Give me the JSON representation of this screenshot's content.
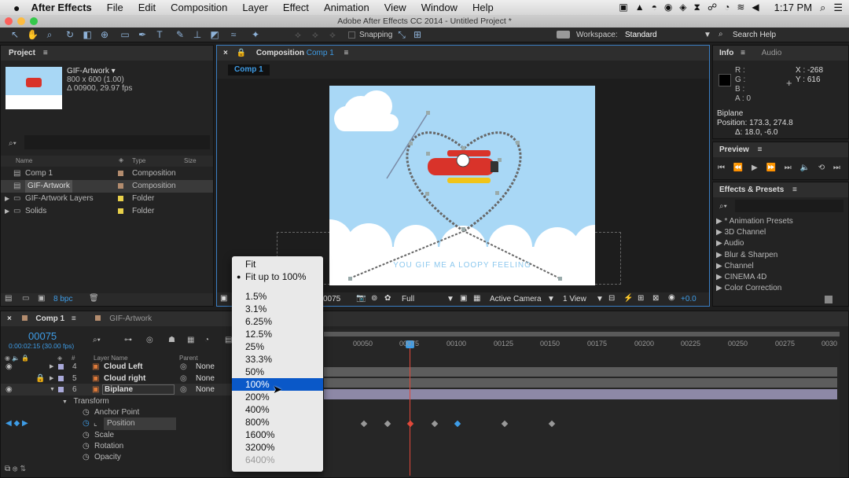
{
  "menubar": {
    "app": "After Effects",
    "items": [
      "File",
      "Edit",
      "Composition",
      "Layer",
      "Effect",
      "Animation",
      "View",
      "Window",
      "Help"
    ],
    "clock": "1:17 PM"
  },
  "window_title": "Adobe After Effects CC 2014 - Untitled Project *",
  "toolbar": {
    "snapping": "Snapping",
    "workspace_label": "Workspace:",
    "workspace_value": "Standard",
    "search_help": "Search Help"
  },
  "project": {
    "title": "Project",
    "footage_name": "GIF-Artwork ▾",
    "footage_size": "800 x 600 (1.00)",
    "footage_duration": "Δ 00900, 29.97 fps",
    "col_name": "Name",
    "col_type": "Type",
    "col_size": "Size",
    "bpc": "8 bpc",
    "items": [
      {
        "name": "Comp 1",
        "type": "Composition",
        "color": "#b38c6e"
      },
      {
        "name": "GIF-Artwork",
        "type": "Composition",
        "color": "#b38c6e"
      },
      {
        "name": "GIF-Artwork Layers",
        "type": "Folder",
        "color": "#e8d04a"
      },
      {
        "name": "Solids",
        "type": "Folder",
        "color": "#e8d04a"
      }
    ]
  },
  "composition": {
    "tab_label": "Composition",
    "tab_name": "Comp 1",
    "sub_tab": "Comp 1",
    "canvas_text": "YOU GIF ME A LOOPY FEELING",
    "footer": {
      "timecode": "0075",
      "resolution": "Full",
      "camera": "Active Camera",
      "view": "1 View",
      "exposure": "+0.0"
    }
  },
  "info": {
    "title": "Info",
    "audio_tab": "Audio",
    "r": "R :",
    "g": "G :",
    "b": "B :",
    "a": "A : 0",
    "x": "X : -268",
    "y": "Y : 616",
    "layer": "Biplane",
    "position": "Position: 173.3, 274.8",
    "delta": "Δ: 18.0, -6.0"
  },
  "preview": {
    "title": "Preview"
  },
  "effects": {
    "title": "Effects & Presets",
    "items": [
      "* Animation Presets",
      "3D Channel",
      "Audio",
      "Blur & Sharpen",
      "Channel",
      "CINEMA 4D",
      "Color Correction"
    ]
  },
  "timeline": {
    "tab1": "Comp 1",
    "tab2": "GIF-Artwork",
    "timecode": "00075",
    "timecode_sub": "0:00:02:15 (30.00 fps)",
    "col_layer_name": "Layer Name",
    "col_parent": "Parent",
    "layers": [
      {
        "num": "4",
        "name": "Cloud Left",
        "parent": "None"
      },
      {
        "num": "5",
        "name": "Cloud right",
        "parent": "None"
      },
      {
        "num": "6",
        "name": "Biplane",
        "parent": "None"
      }
    ],
    "transform": "Transform",
    "props": [
      "Anchor Point",
      "Position",
      "Scale",
      "Rotation",
      "Opacity"
    ],
    "ruler": [
      "00050",
      "00075",
      "00100",
      "00125",
      "00150",
      "00175",
      "00200",
      "00225",
      "00250",
      "00275",
      "0030"
    ]
  },
  "dropdown": {
    "options": [
      "Fit",
      "Fit up to 100%",
      "1.5%",
      "3.1%",
      "6.25%",
      "12.5%",
      "25%",
      "33.3%",
      "50%",
      "100%",
      "200%",
      "400%",
      "800%",
      "1600%",
      "3200%",
      "6400%"
    ]
  }
}
